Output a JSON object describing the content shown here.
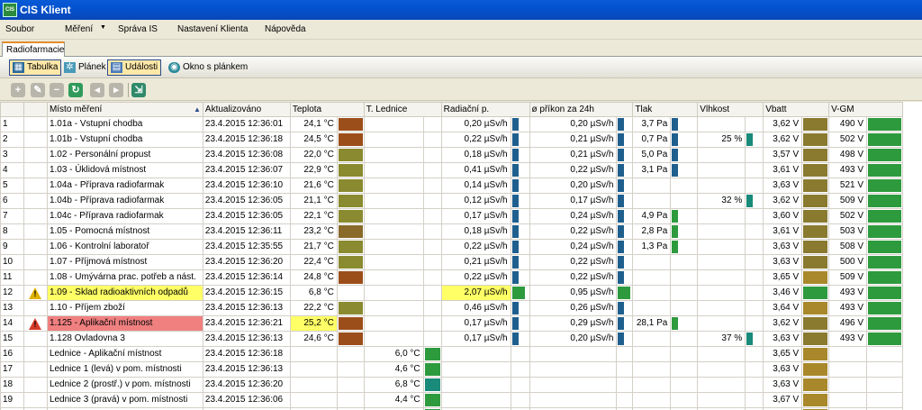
{
  "app": {
    "title": "CIS Klient",
    "icon_text": "CIS"
  },
  "menu": {
    "items": [
      "Soubor",
      "Měření",
      "Správa IS",
      "Nastavení Klienta",
      "Nápověda"
    ],
    "dropdown_index": 1
  },
  "tabs": [
    {
      "label": "Radiofarmacie",
      "active": true
    }
  ],
  "views": [
    {
      "label": "Tabulka",
      "active": true,
      "icon": "table-icon"
    },
    {
      "label": "Plánek",
      "active": false,
      "icon": "plan-icon"
    },
    {
      "label": "Události",
      "active": true,
      "icon": "events-icon"
    },
    {
      "label": "Okno s plánkem",
      "active": false,
      "icon": "eye-icon"
    }
  ],
  "toolbar_icons": [
    "add-icon",
    "edit-icon",
    "remove-icon",
    "refresh-icon",
    "back-icon",
    "forward-icon",
    "export-icon"
  ],
  "columns": [
    "Místo měření",
    "Aktualizováno",
    "Teplota",
    "T. Lednice",
    "Radiační p.",
    "ø příkon za 24h",
    "Tlak",
    "Vlhkost",
    "Vbatt",
    "V-GM"
  ],
  "colors": {
    "warning": "#e0b200",
    "alarm": "#d83a2a",
    "highlight_yellow": "#ffff66",
    "highlight_red": "#f08080",
    "swatch_brown": "#9b4e1a",
    "swatch_olive": "#8a8a30",
    "swatch_green": "#2e9a3e",
    "swatch_blue": "#1f5f8e",
    "swatch_teal": "#1a8a7a",
    "swatch_gold": "#a8882a"
  },
  "rows": [
    {
      "n": "1",
      "warn": "",
      "name": "1.01a - Vstupní chodba",
      "time": "23.4.2015 12:36:01",
      "temp": "24,1 °C",
      "temp_sw": "#9b4e1a",
      "fridge": "",
      "fridge_sw": "",
      "rad": "0,20 µSv/h",
      "rad_sw": "#1f5f8e",
      "avg": "0,20 µSv/h",
      "avg_sw": "#1f5f8e",
      "press": "3,7 Pa",
      "press_sw": "#1f5f8e",
      "hum": "",
      "hum_sw": "",
      "vbatt": "3,62 V",
      "vbatt_sw": "#8a7a30",
      "vgm": "490 V",
      "vgm_sw": "#2e9a3e",
      "hl_name": "",
      "hl_temp": "",
      "hl_rad": ""
    },
    {
      "n": "2",
      "warn": "",
      "name": "1.01b - Vstupní chodba",
      "time": "23.4.2015 12:36:18",
      "temp": "24,5 °C",
      "temp_sw": "#9b4e1a",
      "fridge": "",
      "fridge_sw": "",
      "rad": "0,22 µSv/h",
      "rad_sw": "#1f5f8e",
      "avg": "0,21 µSv/h",
      "avg_sw": "#1f5f8e",
      "press": "0,7 Pa",
      "press_sw": "#1f5f8e",
      "hum": "25 %",
      "hum_sw": "#1a8a7a",
      "vbatt": "3,62 V",
      "vbatt_sw": "#8a7a30",
      "vgm": "502 V",
      "vgm_sw": "#2e9a3e",
      "hl_name": "",
      "hl_temp": "",
      "hl_rad": ""
    },
    {
      "n": "3",
      "warn": "",
      "name": "1.02 - Personální propust",
      "time": "23.4.2015 12:36:08",
      "temp": "22,0 °C",
      "temp_sw": "#8a8a30",
      "fridge": "",
      "fridge_sw": "",
      "rad": "0,18 µSv/h",
      "rad_sw": "#1f5f8e",
      "avg": "0,21 µSv/h",
      "avg_sw": "#1f5f8e",
      "press": "5,0 Pa",
      "press_sw": "#1f5f8e",
      "hum": "",
      "hum_sw": "",
      "vbatt": "3,57 V",
      "vbatt_sw": "#8a7a30",
      "vgm": "498 V",
      "vgm_sw": "#2e9a3e",
      "hl_name": "",
      "hl_temp": "",
      "hl_rad": ""
    },
    {
      "n": "4",
      "warn": "",
      "name": "1.03 - Úklidová místnost",
      "time": "23.4.2015 12:36:07",
      "temp": "22,9 °C",
      "temp_sw": "#8a8a30",
      "fridge": "",
      "fridge_sw": "",
      "rad": "0,41 µSv/h",
      "rad_sw": "#1f5f8e",
      "avg": "0,22 µSv/h",
      "avg_sw": "#1f5f8e",
      "press": "3,1 Pa",
      "press_sw": "#1f5f8e",
      "hum": "",
      "hum_sw": "",
      "vbatt": "3,61 V",
      "vbatt_sw": "#8a7a30",
      "vgm": "493 V",
      "vgm_sw": "#2e9a3e",
      "hl_name": "",
      "hl_temp": "",
      "hl_rad": ""
    },
    {
      "n": "5",
      "warn": "",
      "name": "1.04a - Příprava radiofarmak",
      "time": "23.4.2015 12:36:10",
      "temp": "21,6 °C",
      "temp_sw": "#8a8a30",
      "fridge": "",
      "fridge_sw": "",
      "rad": "0,14 µSv/h",
      "rad_sw": "#1f5f8e",
      "avg": "0,20 µSv/h",
      "avg_sw": "#1f5f8e",
      "press": "",
      "press_sw": "",
      "hum": "",
      "hum_sw": "",
      "vbatt": "3,63 V",
      "vbatt_sw": "#8a7a30",
      "vgm": "521 V",
      "vgm_sw": "#2e9a3e",
      "hl_name": "",
      "hl_temp": "",
      "hl_rad": ""
    },
    {
      "n": "6",
      "warn": "",
      "name": "1.04b - Příprava radiofarmak",
      "time": "23.4.2015 12:36:05",
      "temp": "21,1 °C",
      "temp_sw": "#8a8a30",
      "fridge": "",
      "fridge_sw": "",
      "rad": "0,12 µSv/h",
      "rad_sw": "#1f5f8e",
      "avg": "0,17 µSv/h",
      "avg_sw": "#1f5f8e",
      "press": "",
      "press_sw": "",
      "hum": "32 %",
      "hum_sw": "#1a8a7a",
      "vbatt": "3,62 V",
      "vbatt_sw": "#8a7a30",
      "vgm": "509 V",
      "vgm_sw": "#2e9a3e",
      "hl_name": "",
      "hl_temp": "",
      "hl_rad": ""
    },
    {
      "n": "7",
      "warn": "",
      "name": "1.04c - Příprava radiofarmak",
      "time": "23.4.2015 12:36:05",
      "temp": "22,1 °C",
      "temp_sw": "#8a8a30",
      "fridge": "",
      "fridge_sw": "",
      "rad": "0,17 µSv/h",
      "rad_sw": "#1f5f8e",
      "avg": "0,24 µSv/h",
      "avg_sw": "#1f5f8e",
      "press": "4,9 Pa",
      "press_sw": "#2e9a3e",
      "hum": "",
      "hum_sw": "",
      "vbatt": "3,60 V",
      "vbatt_sw": "#8a7a30",
      "vgm": "502 V",
      "vgm_sw": "#2e9a3e",
      "hl_name": "",
      "hl_temp": "",
      "hl_rad": ""
    },
    {
      "n": "8",
      "warn": "",
      "name": "1.05 - Pomocná místnost",
      "time": "23.4.2015 12:36:11",
      "temp": "23,2 °C",
      "temp_sw": "#8a6a2a",
      "fridge": "",
      "fridge_sw": "",
      "rad": "0,18 µSv/h",
      "rad_sw": "#1f5f8e",
      "avg": "0,22 µSv/h",
      "avg_sw": "#1f5f8e",
      "press": "2,8 Pa",
      "press_sw": "#2e9a3e",
      "hum": "",
      "hum_sw": "",
      "vbatt": "3,61 V",
      "vbatt_sw": "#8a7a30",
      "vgm": "503 V",
      "vgm_sw": "#2e9a3e",
      "hl_name": "",
      "hl_temp": "",
      "hl_rad": ""
    },
    {
      "n": "9",
      "warn": "",
      "name": "1.06 - Kontrolní laboratoř",
      "time": "23.4.2015 12:35:55",
      "temp": "21,7 °C",
      "temp_sw": "#8a8a30",
      "fridge": "",
      "fridge_sw": "",
      "rad": "0,22 µSv/h",
      "rad_sw": "#1f5f8e",
      "avg": "0,24 µSv/h",
      "avg_sw": "#1f5f8e",
      "press": "1,3 Pa",
      "press_sw": "#2e9a3e",
      "hum": "",
      "hum_sw": "",
      "vbatt": "3,63 V",
      "vbatt_sw": "#8a7a30",
      "vgm": "508 V",
      "vgm_sw": "#2e9a3e",
      "hl_name": "",
      "hl_temp": "",
      "hl_rad": ""
    },
    {
      "n": "10",
      "warn": "",
      "name": "1.07 - Příjmová místnost",
      "time": "23.4.2015 12:36:20",
      "temp": "22,4 °C",
      "temp_sw": "#8a8a30",
      "fridge": "",
      "fridge_sw": "",
      "rad": "0,21 µSv/h",
      "rad_sw": "#1f5f8e",
      "avg": "0,22 µSv/h",
      "avg_sw": "#1f5f8e",
      "press": "",
      "press_sw": "",
      "hum": "",
      "hum_sw": "",
      "vbatt": "3,63 V",
      "vbatt_sw": "#8a7a30",
      "vgm": "500 V",
      "vgm_sw": "#2e9a3e",
      "hl_name": "",
      "hl_temp": "",
      "hl_rad": ""
    },
    {
      "n": "11",
      "warn": "",
      "name": "1.08 - Umývárna prac. potřeb a nást.",
      "time": "23.4.2015 12:36:14",
      "temp": "24,8 °C",
      "temp_sw": "#9b4e1a",
      "fridge": "",
      "fridge_sw": "",
      "rad": "0,22 µSv/h",
      "rad_sw": "#1f5f8e",
      "avg": "0,22 µSv/h",
      "avg_sw": "#1f5f8e",
      "press": "",
      "press_sw": "",
      "hum": "",
      "hum_sw": "",
      "vbatt": "3,65 V",
      "vbatt_sw": "#a8882a",
      "vgm": "509 V",
      "vgm_sw": "#2e9a3e",
      "hl_name": "",
      "hl_temp": "",
      "hl_rad": ""
    },
    {
      "n": "12",
      "warn": "yellow",
      "name": "1.09 - Sklad radioaktivních odpadů",
      "time": "23.4.2015 12:36:15",
      "temp": "6,8 °C",
      "temp_sw": "",
      "fridge": "",
      "fridge_sw": "",
      "rad": "2,07 µSv/h",
      "rad_sw": "#2e9a3e",
      "avg": "0,95 µSv/h",
      "avg_sw": "#2e9a3e",
      "press": "",
      "press_sw": "",
      "hum": "",
      "hum_sw": "",
      "vbatt": "3,46 V",
      "vbatt_sw": "#2e9a3e",
      "vgm": "493 V",
      "vgm_sw": "#2e9a3e",
      "hl_name": "yellow",
      "hl_temp": "",
      "hl_rad": "yellow"
    },
    {
      "n": "13",
      "warn": "",
      "name": "1.10 - Příjem zboží",
      "time": "23.4.2015 12:36:13",
      "temp": "22,2 °C",
      "temp_sw": "#8a8a30",
      "fridge": "",
      "fridge_sw": "",
      "rad": "0,46 µSv/h",
      "rad_sw": "#1f5f8e",
      "avg": "0,26 µSv/h",
      "avg_sw": "#1f5f8e",
      "press": "",
      "press_sw": "",
      "hum": "",
      "hum_sw": "",
      "vbatt": "3,64 V",
      "vbatt_sw": "#a8882a",
      "vgm": "493 V",
      "vgm_sw": "#2e9a3e",
      "hl_name": "",
      "hl_temp": "",
      "hl_rad": ""
    },
    {
      "n": "14",
      "warn": "red",
      "name": "1.125 - Aplikační místnost",
      "time": "23.4.2015 12:36:21",
      "temp": "25,2 °C",
      "temp_sw": "#9b4e1a",
      "fridge": "",
      "fridge_sw": "",
      "rad": "0,17 µSv/h",
      "rad_sw": "#1f5f8e",
      "avg": "0,29 µSv/h",
      "avg_sw": "#1f5f8e",
      "press": "28,1 Pa",
      "press_sw": "#2e9a3e",
      "hum": "",
      "hum_sw": "",
      "vbatt": "3,62 V",
      "vbatt_sw": "#8a7a30",
      "vgm": "496 V",
      "vgm_sw": "#2e9a3e",
      "hl_name": "red",
      "hl_temp": "yellow",
      "hl_rad": ""
    },
    {
      "n": "15",
      "warn": "",
      "name": "1.128 Ovladovna 3",
      "time": "23.4.2015 12:36:13",
      "temp": "24,6 °C",
      "temp_sw": "#9b4e1a",
      "fridge": "",
      "fridge_sw": "",
      "rad": "0,17 µSv/h",
      "rad_sw": "#1f5f8e",
      "avg": "0,20 µSv/h",
      "avg_sw": "#1f5f8e",
      "press": "",
      "press_sw": "",
      "hum": "37 %",
      "hum_sw": "#1a8a7a",
      "vbatt": "3,63 V",
      "vbatt_sw": "#8a7a30",
      "vgm": "493 V",
      "vgm_sw": "#2e9a3e",
      "hl_name": "",
      "hl_temp": "",
      "hl_rad": ""
    },
    {
      "n": "16",
      "warn": "",
      "name": "Lednice - Aplikační místnost",
      "time": "23.4.2015 12:36:18",
      "temp": "",
      "temp_sw": "",
      "fridge": "6,0 °C",
      "fridge_sw": "#2e9a3e",
      "rad": "",
      "rad_sw": "",
      "avg": "",
      "avg_sw": "",
      "press": "",
      "press_sw": "",
      "hum": "",
      "hum_sw": "",
      "vbatt": "3,65 V",
      "vbatt_sw": "#a8882a",
      "vgm": "",
      "vgm_sw": "",
      "hl_name": "",
      "hl_temp": "",
      "hl_rad": ""
    },
    {
      "n": "17",
      "warn": "",
      "name": "Lednice 1 (levá) v pom. místnosti",
      "time": "23.4.2015 12:36:13",
      "temp": "",
      "temp_sw": "",
      "fridge": "4,6 °C",
      "fridge_sw": "#2e9a3e",
      "rad": "",
      "rad_sw": "",
      "avg": "",
      "avg_sw": "",
      "press": "",
      "press_sw": "",
      "hum": "",
      "hum_sw": "",
      "vbatt": "3,63 V",
      "vbatt_sw": "#a8882a",
      "vgm": "",
      "vgm_sw": "",
      "hl_name": "",
      "hl_temp": "",
      "hl_rad": ""
    },
    {
      "n": "18",
      "warn": "",
      "name": "Lednice 2 (prostř.) v pom. místnosti",
      "time": "23.4.2015 12:36:20",
      "temp": "",
      "temp_sw": "",
      "fridge": "6,8 °C",
      "fridge_sw": "#1a8a7a",
      "rad": "",
      "rad_sw": "",
      "avg": "",
      "avg_sw": "",
      "press": "",
      "press_sw": "",
      "hum": "",
      "hum_sw": "",
      "vbatt": "3,63 V",
      "vbatt_sw": "#a8882a",
      "vgm": "",
      "vgm_sw": "",
      "hl_name": "",
      "hl_temp": "",
      "hl_rad": ""
    },
    {
      "n": "19",
      "warn": "",
      "name": "Lednice 3 (pravá) v pom. místnosti",
      "time": "23.4.2015 12:36:06",
      "temp": "",
      "temp_sw": "",
      "fridge": "4,4 °C",
      "fridge_sw": "#2e9a3e",
      "rad": "",
      "rad_sw": "",
      "avg": "",
      "avg_sw": "",
      "press": "",
      "press_sw": "",
      "hum": "",
      "hum_sw": "",
      "vbatt": "3,67 V",
      "vbatt_sw": "#a8882a",
      "vgm": "",
      "vgm_sw": "",
      "hl_name": "",
      "hl_temp": "",
      "hl_rad": ""
    },
    {
      "n": "20",
      "warn": "",
      "name": "Lednice v příjmu zboží",
      "time": "23.4.2015 12:36:17",
      "temp": "",
      "temp_sw": "",
      "fridge": "5,5 °C",
      "fridge_sw": "#2e9a3e",
      "rad": "",
      "rad_sw": "",
      "avg": "",
      "avg_sw": "",
      "press": "",
      "press_sw": "",
      "hum": "",
      "hum_sw": "",
      "vbatt": "3,64 V",
      "vbatt_sw": "#a8882a",
      "vgm": "",
      "vgm_sw": "",
      "hl_name": "",
      "hl_temp": "",
      "hl_rad": ""
    }
  ]
}
